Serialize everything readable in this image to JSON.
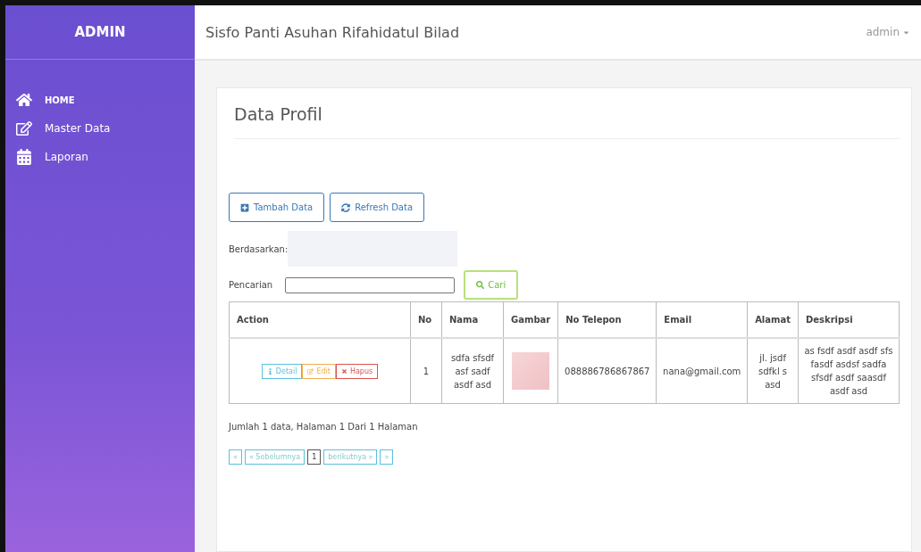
{
  "sidebar": {
    "brand": "ADMIN",
    "items": [
      {
        "label": "HOME",
        "kind": "home",
        "selected": true
      },
      {
        "label": "Master Data",
        "kind": "edit",
        "selected": false
      },
      {
        "label": "Laporan",
        "kind": "calendar",
        "selected": false
      }
    ]
  },
  "header": {
    "title": "Sisfo Panti Asuhan Rifahidatul Bilad",
    "user": "admin"
  },
  "page": {
    "title": "Data Profil",
    "buttons": [
      {
        "label": "Tambah Data",
        "kind": "add"
      },
      {
        "label": "Refresh Data",
        "kind": "refresh"
      }
    ],
    "filter": {
      "label": "Berdasarkan:"
    },
    "search": {
      "label": "Pencarian",
      "button": "Cari"
    },
    "table": {
      "columns": [
        "Action",
        "No",
        "Nama",
        "Gambar",
        "No Telepon",
        "Email",
        "Alamat",
        "Deskripsi"
      ],
      "rows": [
        {
          "actions": [
            {
              "label": "Detail",
              "kind": "info"
            },
            {
              "label": "Edit",
              "kind": "warning"
            },
            {
              "label": "Hapus",
              "kind": "danger"
            }
          ],
          "no": "1",
          "nama": "sdfa sfsdf asf sadf asdf asd",
          "telepon": "088886786867867",
          "email": "nana@gmail.com",
          "alamat": "jl. jsdf sdfkl s asd",
          "deskripsi": "as fsdf asdf asdf sfs fasdf asdsf sadfa sfsdf asdf saasdf asdf asd"
        }
      ]
    },
    "summary": "Jumlah 1 data, Halaman 1 Dari 1 Halaman",
    "pagination": [
      {
        "label": "«",
        "selected": false
      },
      {
        "label": "« Sebelumnya",
        "selected": false
      },
      {
        "label": "1",
        "selected": true
      },
      {
        "label": "berikutnya »",
        "selected": false
      },
      {
        "label": "»",
        "selected": false
      }
    ]
  }
}
